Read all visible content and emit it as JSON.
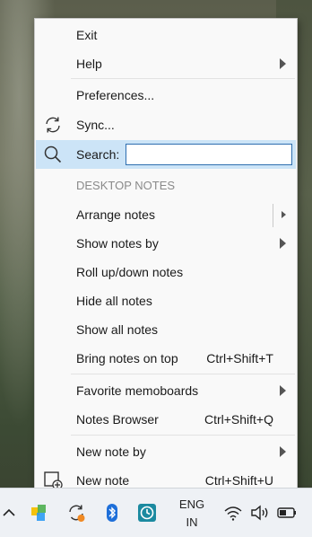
{
  "menu": {
    "exit": "Exit",
    "help": "Help",
    "preferences": "Preferences...",
    "sync": "Sync...",
    "search_label": "Search:",
    "search_value": "",
    "section_header": "DESKTOP NOTES",
    "arrange_notes": "Arrange notes",
    "show_notes_by": "Show notes by",
    "roll_up_down": "Roll up/down notes",
    "hide_all": "Hide all notes",
    "show_all": "Show all notes",
    "bring_on_top": "Bring notes on top",
    "bring_on_top_shortcut": "Ctrl+Shift+T",
    "favorite_memoboards": "Favorite memoboards",
    "notes_browser": "Notes Browser",
    "notes_browser_shortcut": "Ctrl+Shift+Q",
    "new_note_by": "New note by",
    "new_note": "New note",
    "new_note_shortcut": "Ctrl+Shift+U"
  },
  "taskbar": {
    "lang_top": "ENG",
    "lang_bottom": "IN",
    "icons": [
      "chevron-up-icon",
      "app-tiles-icon",
      "sync-app-icon",
      "bluetooth-icon",
      "timer-app-icon",
      "wifi-icon",
      "volume-icon",
      "battery-icon"
    ]
  },
  "colors": {
    "highlight": "#cce4f7",
    "search_border": "#2f6fb0",
    "header_text": "#8a8a8a"
  }
}
